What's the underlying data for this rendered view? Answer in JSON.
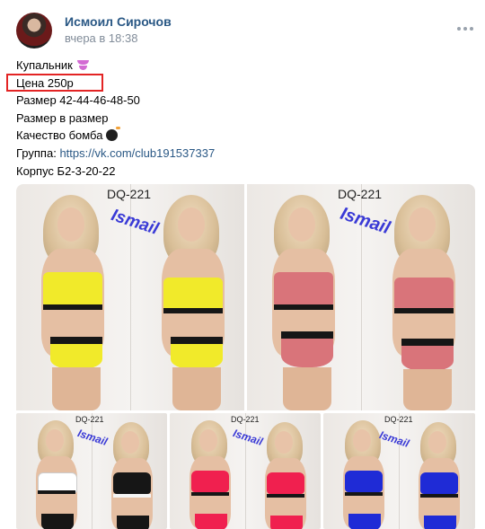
{
  "post": {
    "author": "Исмоил Сирочов",
    "time": "вчера в 18:38",
    "lines": {
      "title": "Купальник",
      "price": "Цена 250р",
      "sizes": "Размер 42-44-46-48-50",
      "fit": "Размер в размер",
      "quality": "Качество бомба",
      "group_label": "Группа:",
      "group_link": "https://vk.com/club191537337",
      "address": "Корпус Б2-3-20-22"
    }
  },
  "photos": {
    "code": "DQ-221",
    "watermark": "Ismail",
    "colors": {
      "yellow": "#f1ea2a",
      "pink": "#d9747a",
      "black": "#161616",
      "red": "#f0204f",
      "blue": "#1f2bd6"
    }
  },
  "icons": {
    "more": "more-horizontal-icon",
    "title_emoji": "bikini-emoji",
    "quality_emoji": "bomb-emoji"
  },
  "theme": {
    "link_color": "#2a5885",
    "meta_color": "#818c99",
    "highlight": "#e32424"
  }
}
